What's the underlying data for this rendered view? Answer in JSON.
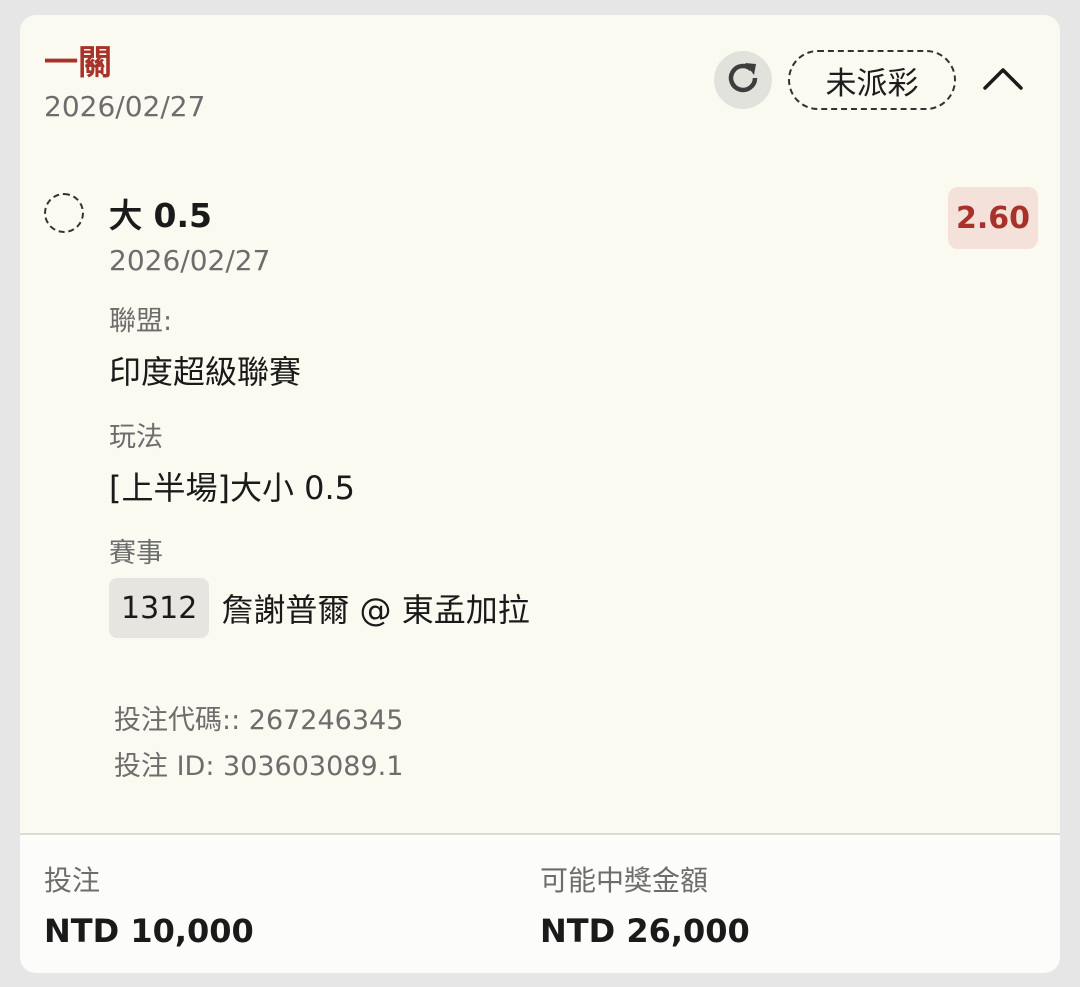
{
  "header": {
    "bet_type": "一關",
    "date": "2026/02/27",
    "status": "未派彩",
    "refresh_icon": "refresh-icon",
    "collapse_icon": "chevron-up-icon"
  },
  "selection": {
    "name": "大 0.5",
    "date": "2026/02/27",
    "odds": "2.60",
    "league_label": "聯盟:",
    "league_value": "印度超級聯賽",
    "market_label": "玩法",
    "market_value": "[上半場]大小 0.5",
    "event_label": "賽事",
    "event_id": "1312",
    "event_name": "詹謝普爾 @ 東孟加拉"
  },
  "meta": {
    "bet_code": "投注代碼:: 267246345",
    "bet_id": "投注 ID: 303603089.1"
  },
  "footer": {
    "stake_label": "投注",
    "stake_value": "NTD 10,000",
    "payout_label": "可能中獎金額",
    "payout_value": "NTD 26,000"
  },
  "colors": {
    "accent": "#a8322a",
    "card_bg": "#fbfaf1",
    "odds_bg": "#f3e1da"
  }
}
